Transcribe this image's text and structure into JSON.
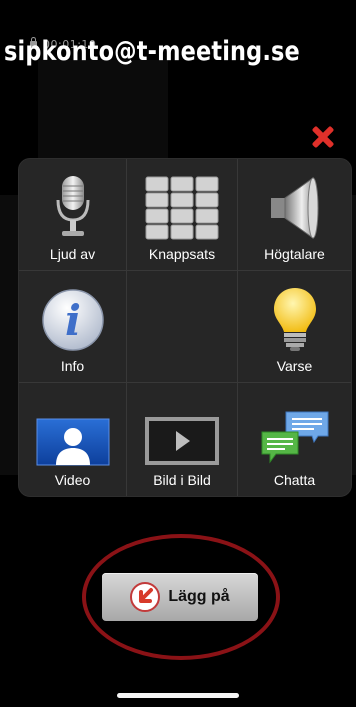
{
  "status": {
    "timer": "00:01:10"
  },
  "header": {
    "title": "sipkonto@t-meeting.se"
  },
  "menu": {
    "items": [
      {
        "label": "Ljud av",
        "icon": "microphone-icon"
      },
      {
        "label": "Knappsats",
        "icon": "keypad-icon"
      },
      {
        "label": "Högtalare",
        "icon": "speaker-icon"
      },
      {
        "label": "Info",
        "icon": "info-icon"
      },
      {
        "label": "",
        "icon": ""
      },
      {
        "label": "Varse",
        "icon": "lightbulb-icon"
      },
      {
        "label": "Video",
        "icon": "video-contact-icon"
      },
      {
        "label": "Bild i Bild",
        "icon": "picture-in-picture-icon"
      },
      {
        "label": "Chatta",
        "icon": "chat-bubbles-icon"
      }
    ]
  },
  "actions": {
    "hangup_label": "Lägg på"
  },
  "colors": {
    "close": "#e0302a",
    "highlight_ring": "#8a1216",
    "panel": "#262626"
  }
}
